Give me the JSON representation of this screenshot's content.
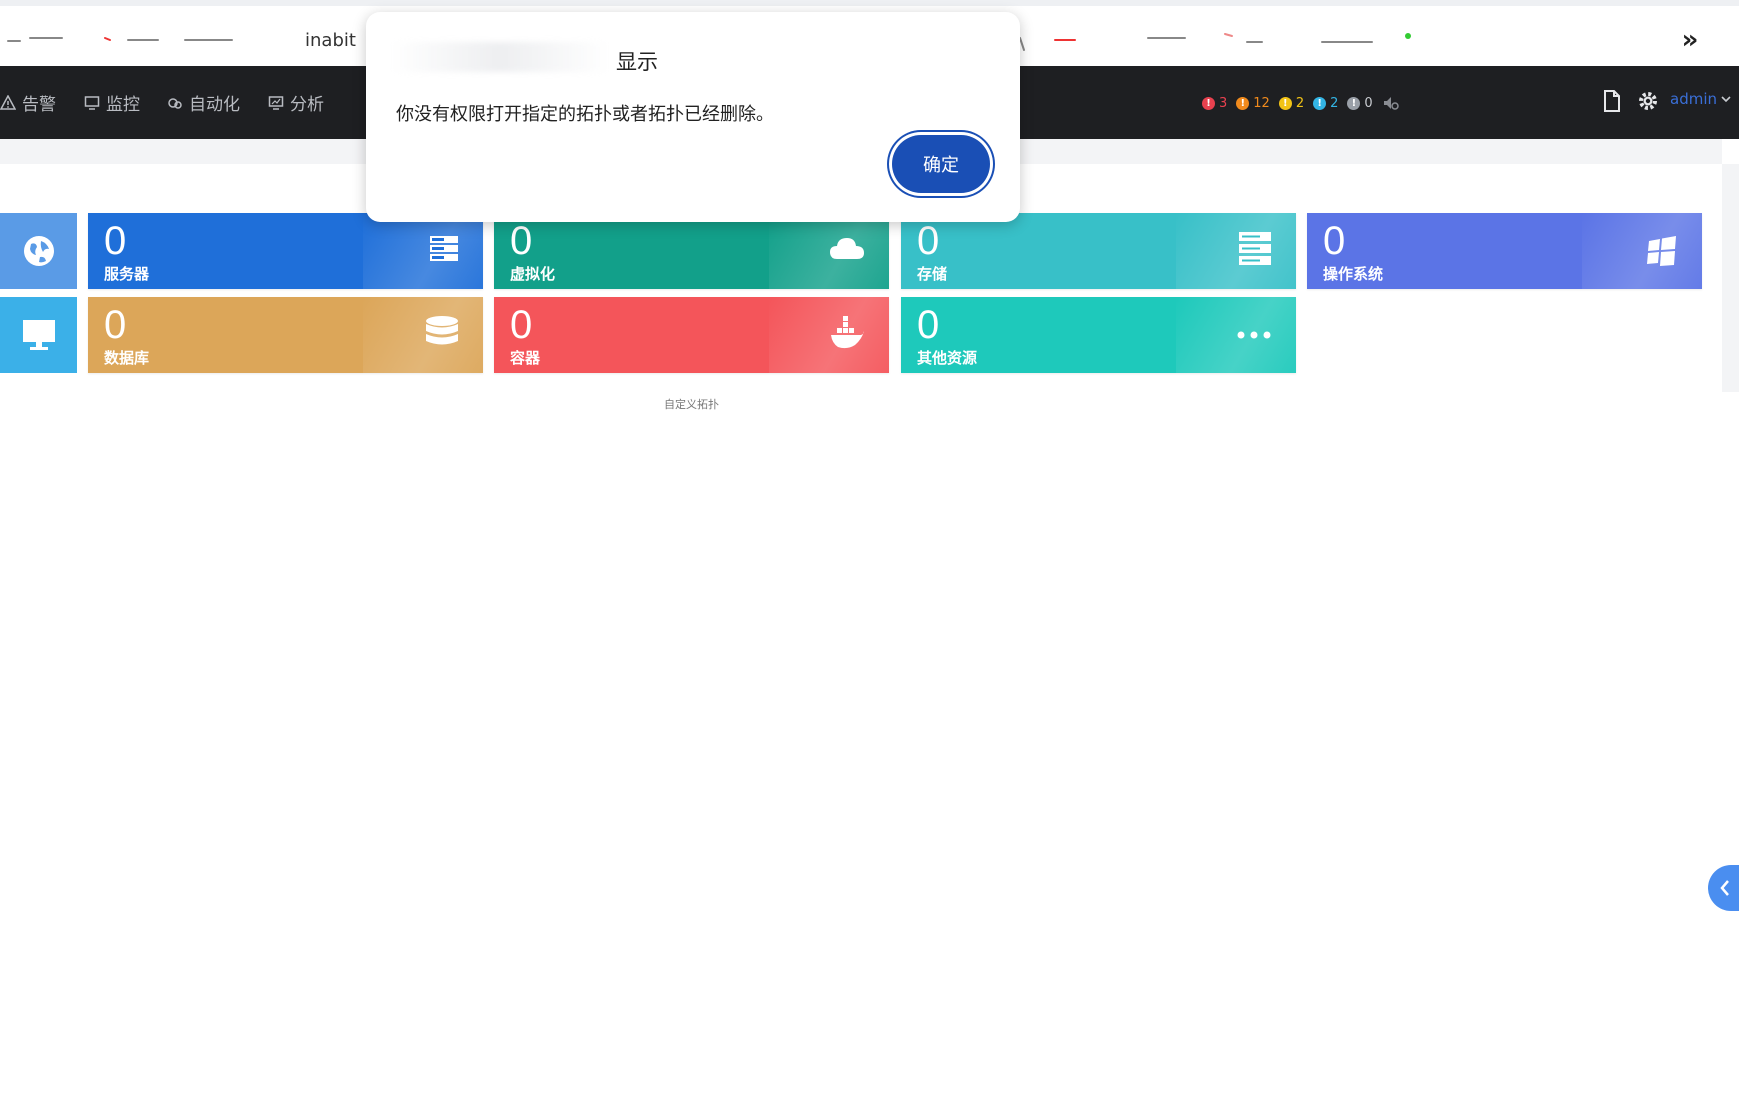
{
  "bookmarks": {
    "partial_label": "inabit",
    "more": "»"
  },
  "nav": {
    "items": [
      {
        "label": "告警",
        "icon": "warning-icon"
      },
      {
        "label": "监控",
        "icon": "monitor-icon"
      },
      {
        "label": "自动化",
        "icon": "automation-icon"
      },
      {
        "label": "分析",
        "icon": "analysis-icon"
      }
    ],
    "alerts": [
      {
        "color": "#e8414f",
        "count": "3"
      },
      {
        "color": "#f08a1d",
        "count": "12"
      },
      {
        "color": "#f2c316",
        "count": "2"
      },
      {
        "color": "#33b5e5",
        "count": "2"
      },
      {
        "color": "#9aa0a8",
        "count": "0"
      }
    ],
    "user": "admin"
  },
  "tiles": {
    "row1": [
      {
        "value": "0",
        "label": "服务器",
        "color": "#1f6fd9",
        "icon": "server-icon"
      },
      {
        "value": "0",
        "label": "虚拟化",
        "color": "#12a08a",
        "icon": "cloud-icon"
      },
      {
        "value": "0",
        "label": "存储",
        "color": "#38c0c8",
        "icon": "storage-icon"
      },
      {
        "value": "0",
        "label": "操作系统",
        "color": "#5b74e6",
        "icon": "windows-icon"
      }
    ],
    "row2": [
      {
        "value": "0",
        "label": "数据库",
        "color": "#dca659",
        "icon": "database-icon"
      },
      {
        "value": "0",
        "label": "容器",
        "color": "#f4555a",
        "icon": "docker-icon"
      },
      {
        "value": "0",
        "label": "其他资源",
        "color": "#1ec9bb",
        "icon": "more-icon"
      }
    ]
  },
  "caption": "自定义拓扑",
  "dialog": {
    "title": "显示",
    "message": "你没有权限打开指定的拓扑或者拓扑已经删除。",
    "ok_label": "确定"
  }
}
